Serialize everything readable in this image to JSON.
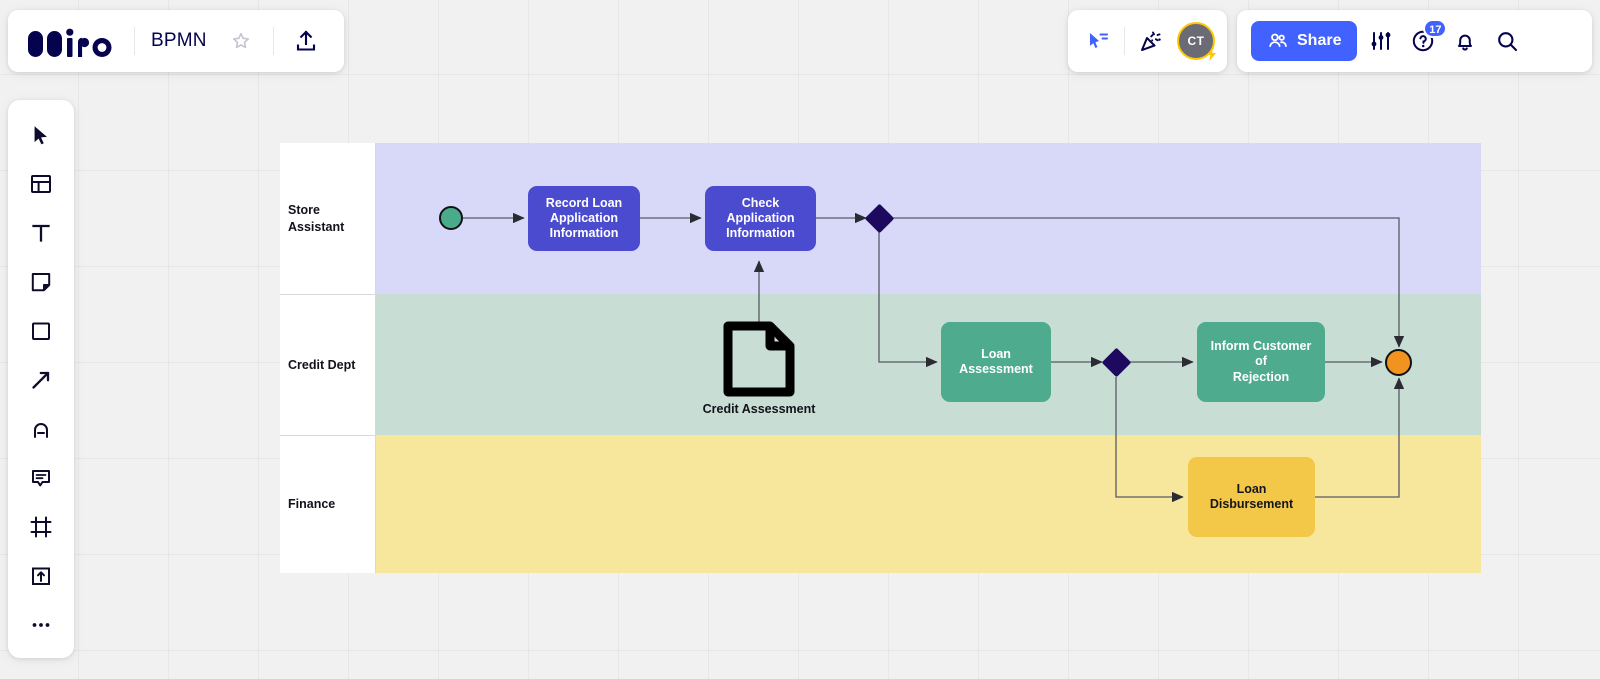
{
  "app": {
    "logo_text": "miro"
  },
  "header": {
    "board_title": "BPMN",
    "favorite_icon": "star-icon",
    "upload_icon": "upload-icon",
    "presentation_icon": "presentation-cursor-icon",
    "celebration_icon": "party-popper-icon",
    "avatar_initials": "CT",
    "avatar_badge_icon": "lightning-bolt-icon",
    "share_label": "Share",
    "share_icon": "people-icon",
    "settings_icon": "sliders-icon",
    "help_icon": "question-mark-icon",
    "help_badge_count": "17",
    "notifications_icon": "bell-icon",
    "search_icon": "search-icon",
    "accent_color": "#4262ff",
    "avatar_ring_color": "#ffc700"
  },
  "toolbar": {
    "items": [
      {
        "name": "select-tool",
        "icon": "cursor-arrow-icon"
      },
      {
        "name": "templates-tool",
        "icon": "templates-icon"
      },
      {
        "name": "text-tool",
        "icon": "text-t-icon"
      },
      {
        "name": "sticky-note-tool",
        "icon": "sticky-note-icon"
      },
      {
        "name": "shapes-tool",
        "icon": "square-shape-icon"
      },
      {
        "name": "connector-tool",
        "icon": "arrow-diagonal-icon"
      },
      {
        "name": "pen-tool",
        "icon": "pen-draw-icon"
      },
      {
        "name": "comment-tool",
        "icon": "comment-bubble-icon"
      },
      {
        "name": "frame-tool",
        "icon": "frame-icon"
      },
      {
        "name": "upload-tool",
        "icon": "upload-box-icon"
      },
      {
        "name": "more-tools",
        "icon": "ellipsis-icon"
      }
    ]
  },
  "diagram": {
    "type": "bpmn",
    "lanes": [
      {
        "id": "store-assistant",
        "label": "Store\nAssistant",
        "label_line1": "Store",
        "label_line2": "Assistant",
        "color": "#d8d9f8"
      },
      {
        "id": "credit-dept",
        "label": "Credit Dept",
        "label_line1": "Credit Dept",
        "label_line2": "",
        "color": "#c8ddd3"
      },
      {
        "id": "finance",
        "label": "Finance",
        "label_line1": "Finance",
        "label_line2": "",
        "color": "#f6e79d"
      }
    ],
    "nodes": [
      {
        "id": "start-event",
        "kind": "start-event",
        "lane": "store-assistant",
        "label": "",
        "color": "#49ab8a"
      },
      {
        "id": "record-loan",
        "kind": "task",
        "lane": "store-assistant",
        "label": "Record Loan Application Information",
        "color": "#4b4bd0"
      },
      {
        "id": "check-application",
        "kind": "task",
        "lane": "store-assistant",
        "label": "Check Application Information",
        "color": "#4b4bd0"
      },
      {
        "id": "gateway-1",
        "kind": "gateway",
        "lane": "store-assistant",
        "label": "",
        "color": "#1d0a5e"
      },
      {
        "id": "credit-assessment",
        "kind": "data-object",
        "lane": "credit-dept",
        "label": "Credit Assessment",
        "color": "#000000"
      },
      {
        "id": "loan-assessment",
        "kind": "task",
        "lane": "credit-dept",
        "label": "Loan Assessment",
        "color": "#4fab8d"
      },
      {
        "id": "gateway-2",
        "kind": "gateway",
        "lane": "credit-dept",
        "label": "",
        "color": "#1d0a5e"
      },
      {
        "id": "inform-rejection",
        "kind": "task",
        "lane": "credit-dept",
        "label": "Inform Customer of Rejection",
        "color": "#4fab8d"
      },
      {
        "id": "end-event",
        "kind": "end-event",
        "lane": "credit-dept",
        "label": "",
        "color": "#f2921f"
      },
      {
        "id": "loan-disbursement",
        "kind": "task",
        "lane": "finance",
        "label": "Loan Disbursement",
        "color": "#f3c747"
      }
    ],
    "task_labels": {
      "record_loan_l1": "Record Loan",
      "record_loan_l2": "Application",
      "record_loan_l3": "Information",
      "check_app_l1": "Check Application",
      "check_app_l2": "Information",
      "credit_assessment": "Credit Assessment",
      "loan_assessment": "Loan Assessment",
      "inform_rejection_l1": "Inform Customer of",
      "inform_rejection_l2": "Rejection",
      "loan_disb_l1": "Loan",
      "loan_disb_l2": "Disbursement"
    },
    "flows": [
      {
        "from": "start-event",
        "to": "record-loan"
      },
      {
        "from": "record-loan",
        "to": "check-application"
      },
      {
        "from": "credit-assessment",
        "to": "check-application"
      },
      {
        "from": "check-application",
        "to": "gateway-1"
      },
      {
        "from": "gateway-1",
        "to": "end-event"
      },
      {
        "from": "gateway-1",
        "to": "loan-assessment"
      },
      {
        "from": "loan-assessment",
        "to": "gateway-2"
      },
      {
        "from": "gateway-2",
        "to": "inform-rejection"
      },
      {
        "from": "gateway-2",
        "to": "loan-disbursement"
      },
      {
        "from": "inform-rejection",
        "to": "end-event"
      },
      {
        "from": "loan-disbursement",
        "to": "end-event"
      }
    ]
  }
}
